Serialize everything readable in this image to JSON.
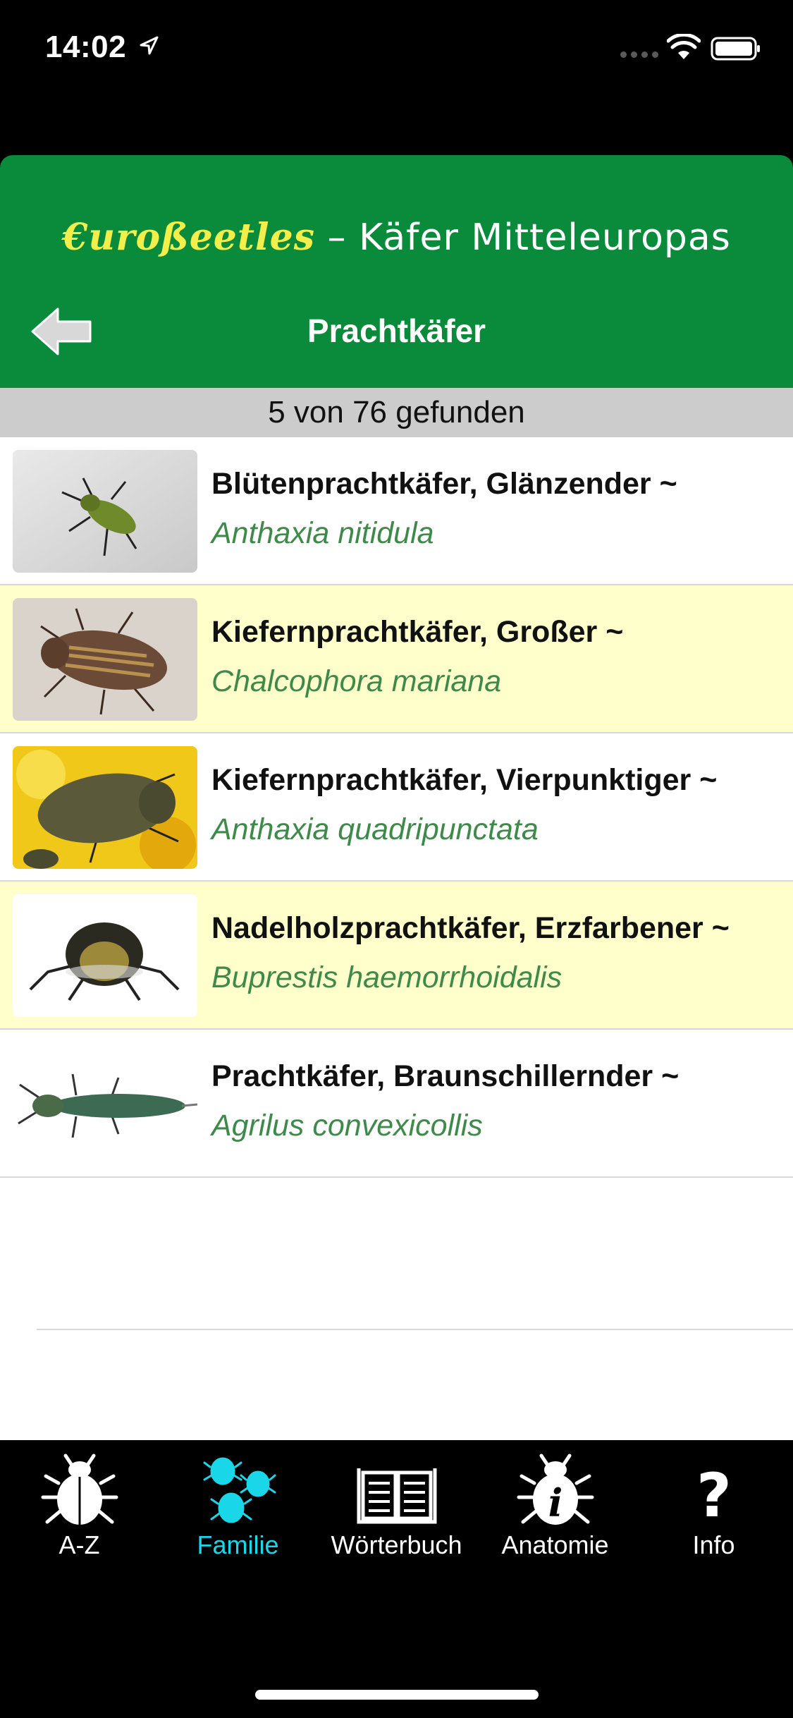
{
  "status_bar": {
    "time": "14:02"
  },
  "header": {
    "app_title_brand": "€uroßeetles",
    "app_title_rest": " – Käfer Mitteleuropas",
    "nav_title": "Prachtkäfer"
  },
  "count_text": "5 von 76 gefunden",
  "list": {
    "items": [
      {
        "name": "Blütenprachtkäfer, Glänzender ~",
        "scientific": "Anthaxia nitidula",
        "highlighted": false
      },
      {
        "name": "Kiefernprachtkäfer, Großer ~",
        "scientific": "Chalcophora mariana",
        "highlighted": true
      },
      {
        "name": "Kiefernprachtkäfer, Vierpunktiger ~",
        "scientific": "Anthaxia quadripunctata",
        "highlighted": false
      },
      {
        "name": "Nadelholzprachtkäfer, Erzfarbener ~",
        "scientific": "Buprestis haemorrhoidalis",
        "highlighted": true
      },
      {
        "name": "Prachtkäfer, Braunschillernder ~",
        "scientific": "Agrilus convexicollis",
        "highlighted": false
      }
    ]
  },
  "tabbar": {
    "tabs": [
      {
        "label": "A-Z",
        "icon": "beetle-icon"
      },
      {
        "label": "Familie",
        "icon": "beetle-family-icon",
        "active": true
      },
      {
        "label": "Wörterbuch",
        "icon": "book-icon"
      },
      {
        "label": "Anatomie",
        "icon": "beetle-info-icon"
      },
      {
        "label": "Info",
        "icon": "question-icon"
      }
    ]
  },
  "colors": {
    "header_green": "#0a8a3b",
    "brand_yellow": "#f2ef4a",
    "highlight_row": "#ffffcc",
    "scientific_green": "#3f8a4a",
    "active_tab": "#19d6e8"
  }
}
